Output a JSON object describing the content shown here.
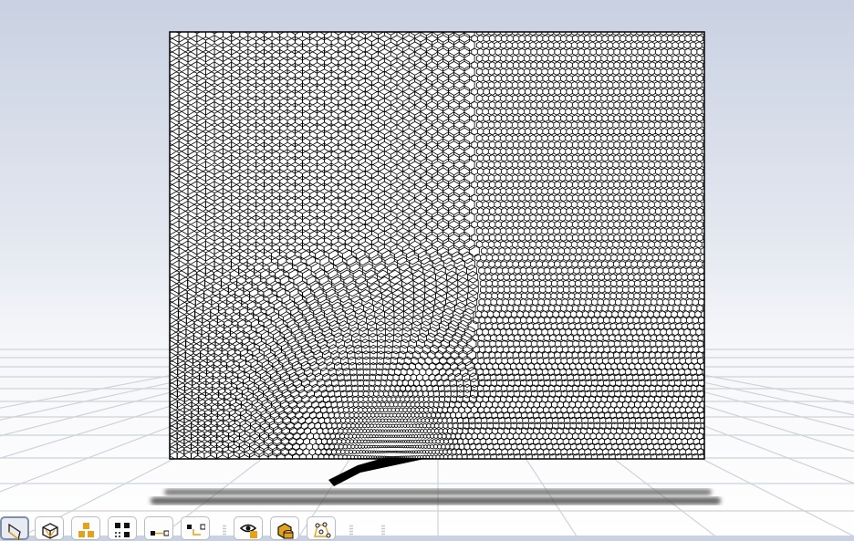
{
  "viewport": {
    "background_top": "#c9d1e2",
    "mesh_line_color": "#000000",
    "mesh_fill_color": "#ffffff",
    "grid_color": "#cfd2d7",
    "shadow_color": "#555555"
  },
  "toolbar": {
    "accent_color": "#e3a21a",
    "buttons": [
      {
        "icon": "select-geometry-icon",
        "active": true
      },
      {
        "icon": "wireframe-box-icon",
        "active": false
      },
      {
        "icon": "bodies-icon",
        "active": false
      },
      {
        "icon": "grid-select-icon",
        "active": false
      },
      {
        "icon": "connect-nodes-icon",
        "active": false
      },
      {
        "icon": "connect-nodes-offset-icon",
        "active": false
      },
      {
        "icon": "show-hide-icon",
        "active": false
      },
      {
        "icon": "boolean-bodies-icon",
        "active": false
      },
      {
        "icon": "network-icon",
        "active": false
      }
    ]
  }
}
